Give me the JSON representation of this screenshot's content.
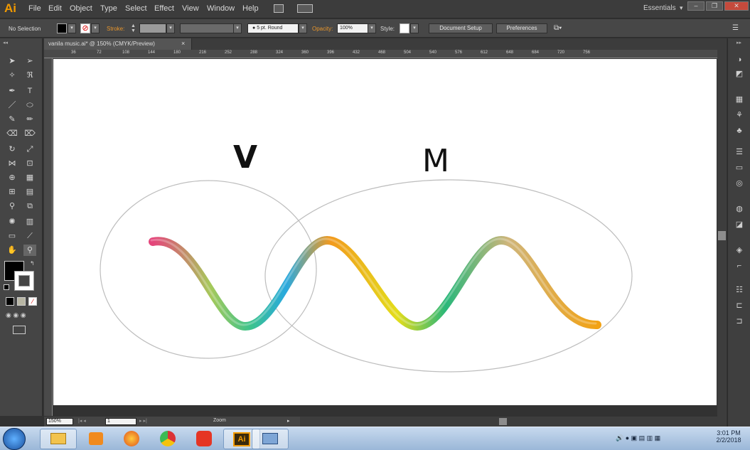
{
  "app": {
    "logo": "Ai"
  },
  "menu": [
    "File",
    "Edit",
    "Object",
    "Type",
    "Select",
    "Effect",
    "View",
    "Window",
    "Help"
  ],
  "workspace": {
    "label": "Essentials"
  },
  "window_controls": {
    "minimize": "–",
    "restore": "❐",
    "close": "✕"
  },
  "control_bar": {
    "selection_label": "No Selection",
    "stroke_label": "Stroke:",
    "brush_label": "5 pt. Round",
    "opacity_label": "Opacity:",
    "opacity_value": "100%",
    "style_label": "Style:",
    "document_setup": "Document Setup",
    "preferences": "Preferences"
  },
  "tab": {
    "title": "vanila music.ai* @ 150% (CMYK/Preview)",
    "close": "×"
  },
  "ruler": {
    "ticks": [
      "36",
      "72",
      "108",
      "144",
      "180",
      "216",
      "252",
      "288",
      "324",
      "360",
      "396",
      "432",
      "468",
      "504",
      "540",
      "576",
      "612",
      "648",
      "684",
      "720",
      "756"
    ]
  },
  "artwork": {
    "label_v": "V",
    "label_m": "M"
  },
  "status": {
    "zoom": "150%",
    "page": "1",
    "mode": "Zoom"
  },
  "taskbar": {
    "time": "3:01 PM",
    "date": "2/2/2018"
  },
  "colors": {
    "accent": "#f29a00",
    "canvas": "#ffffff",
    "chrome": "#323232"
  }
}
